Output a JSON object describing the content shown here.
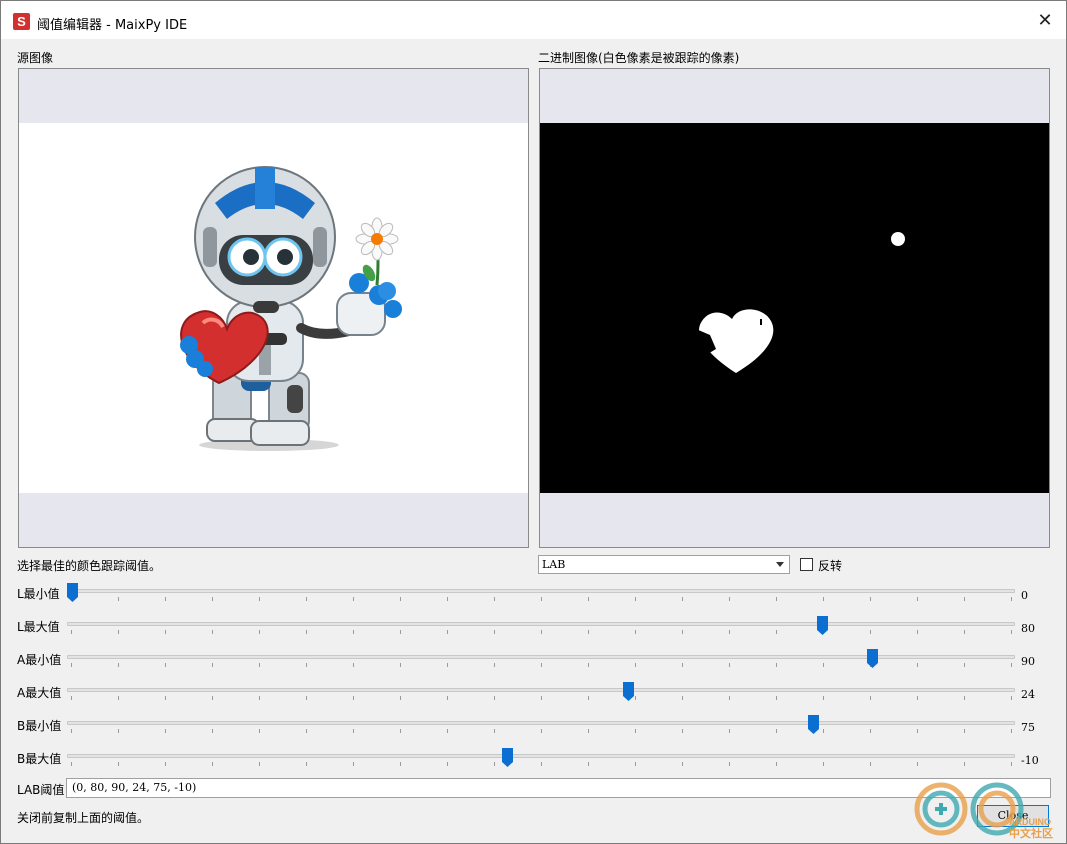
{
  "window": {
    "title": "阈值编辑器 - MaixPy IDE",
    "app_icon_letter": "S",
    "close_glyph": "✕"
  },
  "source_panel": {
    "label": "源图像"
  },
  "binary_panel": {
    "label": "二进制图像(白色像素是被跟踪的像素)"
  },
  "controls": {
    "hint": "选择最佳的颜色跟踪阈值。",
    "color_space": {
      "selected": "LAB"
    },
    "invert": {
      "label": "反转",
      "checked": false
    }
  },
  "sliders": [
    {
      "label": "L最小值",
      "value": "0",
      "position": 0.0
    },
    {
      "label": "L最大值",
      "value": "80",
      "position": 0.8
    },
    {
      "label": "A最小值",
      "value": "90",
      "position": 0.8535
    },
    {
      "label": "A最大值",
      "value": "24",
      "position": 0.5938
    },
    {
      "label": "B最小值",
      "value": "75",
      "position": 0.7913
    },
    {
      "label": "B最大值",
      "value": "-10",
      "position": 0.4638
    }
  ],
  "lab_threshold": {
    "label": "LAB阈值",
    "value": "(0, 80, 90, 24, 75, -10)"
  },
  "footer": {
    "note": "关闭前复制上面的阈值。",
    "close_label": "Close"
  },
  "watermark": {
    "text": "中文社区",
    "brand": "ARDUINO"
  },
  "colors": {
    "slider_handle": "#0a6fd1",
    "window_bg": "#f0f0f0",
    "image_letterbox": "#e6e6ee"
  }
}
